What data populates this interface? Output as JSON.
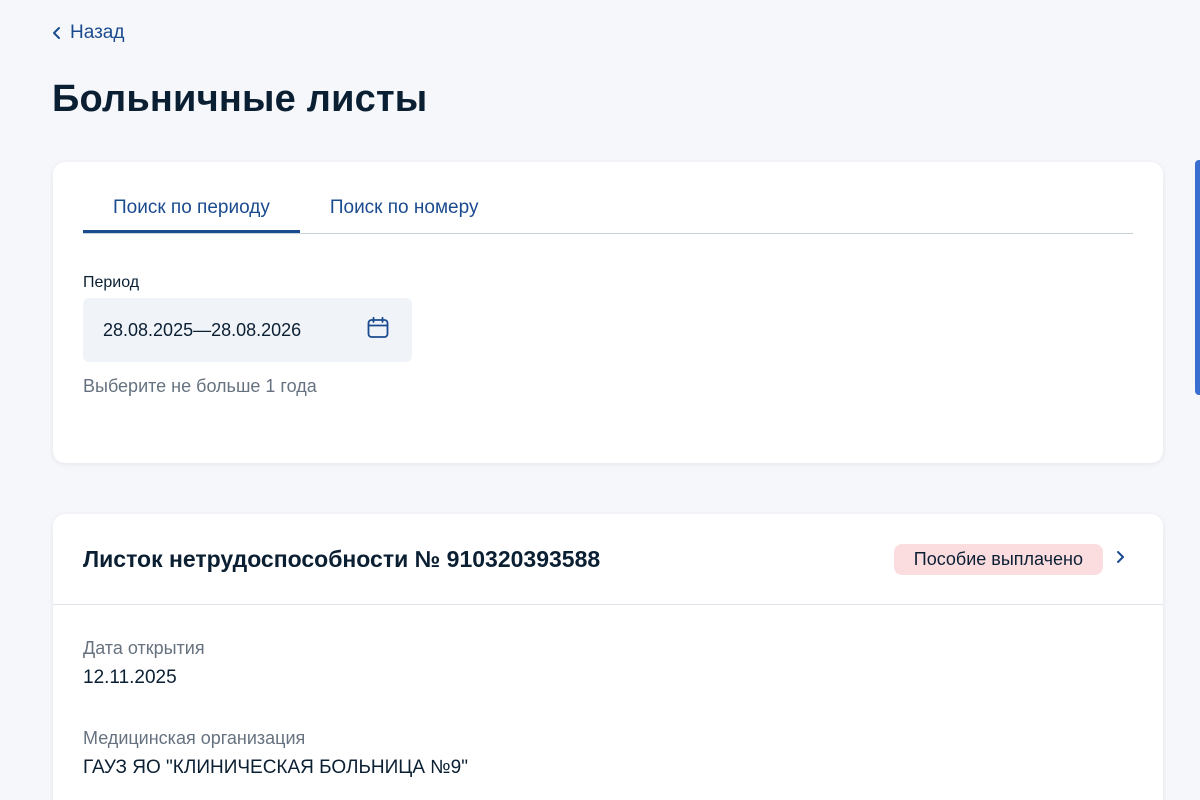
{
  "nav": {
    "back_label": "Назад"
  },
  "page": {
    "title": "Больничные листы"
  },
  "search": {
    "tabs": [
      {
        "label": "Поиск по периоду",
        "active": true
      },
      {
        "label": "Поиск по номеру",
        "active": false
      }
    ],
    "period_label": "Период",
    "period_value": "28.08.2025—28.08.2026",
    "period_hint": "Выберите не больше 1 года",
    "calendar_icon": "calendar-icon"
  },
  "result": {
    "title": "Листок нетрудоспособности № 910320393588",
    "status": "Пособие выплачено",
    "status_color": "#fbdde0",
    "open_date_label": "Дата открытия",
    "open_date_value": "12.11.2025",
    "org_label": "Медицинская организация",
    "org_value": "ГАУЗ ЯО \"КЛИНИЧЕСКАЯ БОЛЬНИЦА №9\""
  },
  "colors": {
    "accent": "#1b4b8f",
    "background": "#f5f7fb",
    "text": "#0b1f33",
    "muted": "#66727f"
  }
}
